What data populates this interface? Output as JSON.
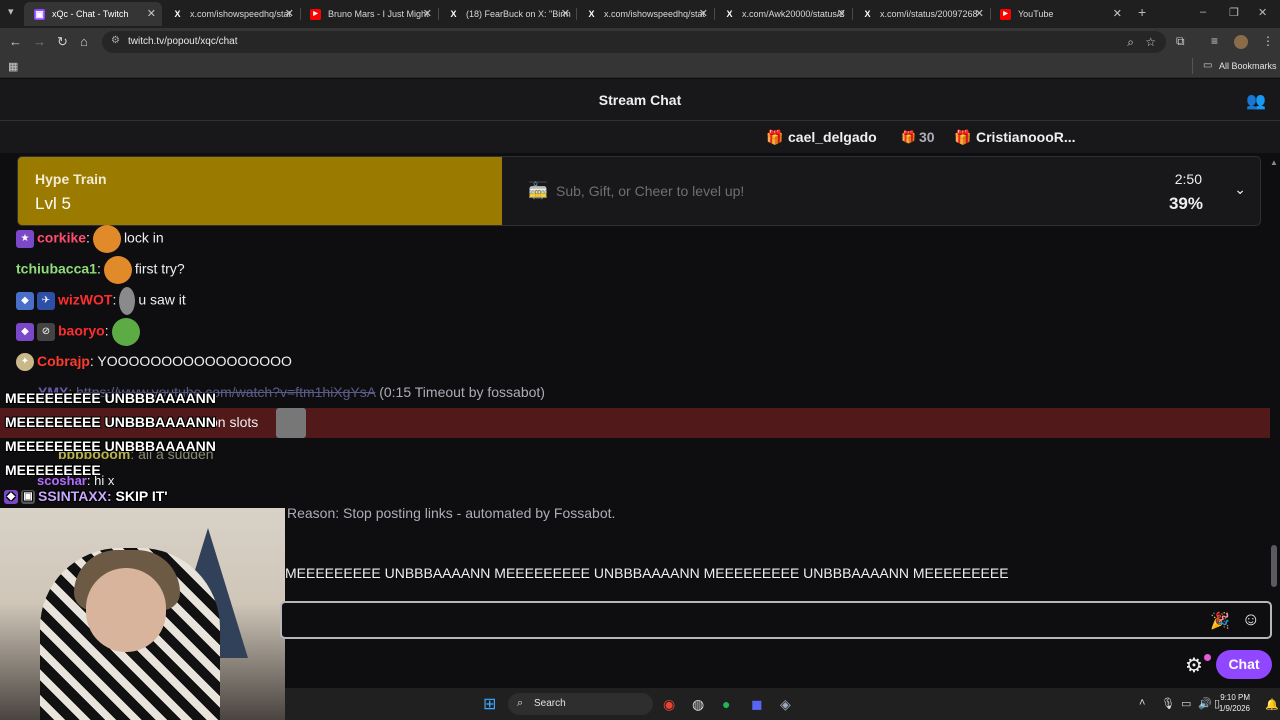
{
  "browser": {
    "tabs": [
      {
        "title": "xQc - Chat - Twitch",
        "active": true,
        "icon": "twitch-icon",
        "color": "#9147ff",
        "glyph": "▣"
      },
      {
        "title": "x.com/ishowspeedhq/stat",
        "icon": "x-icon",
        "color": "#ffffff",
        "glyph": "X"
      },
      {
        "title": "Bruno Mars - I Just Might",
        "icon": "youtube-icon",
        "color": "#ff0000",
        "glyph": "▶"
      },
      {
        "title": "(18) FearBuck on X: \"Birm",
        "icon": "x-icon",
        "color": "#ffffff",
        "glyph": "X"
      },
      {
        "title": "x.com/ishowspeedhq/stat",
        "icon": "x-icon",
        "color": "#ffffff",
        "glyph": "X"
      },
      {
        "title": "x.com/Awk20000/status/2",
        "icon": "x-icon",
        "color": "#ffffff",
        "glyph": "X"
      },
      {
        "title": "x.com/i/status/20097268",
        "icon": "x-icon",
        "color": "#ffffff",
        "glyph": "X"
      },
      {
        "title": "YouTube",
        "icon": "youtube-icon",
        "color": "#ff0000",
        "glyph": "▶"
      }
    ],
    "url": "twitch.tv/popout/xqc/chat",
    "all_bookmarks": "All Bookmarks"
  },
  "chat": {
    "title": "Stream Chat",
    "leaderboard": [
      {
        "name": "cael_delgado",
        "icon": "gift-icon",
        "glyph": "🎁"
      },
      {
        "count": "30",
        "icon": "bits-gift-icon",
        "glyph": "🎁"
      },
      {
        "name": "CristianoooR...",
        "icon": "gift-icon-2",
        "glyph": "🎁"
      }
    ],
    "hype_train": {
      "title": "Hype Train",
      "level": "Lvl 5",
      "cta": "Sub, Gift, or Cheer to level up!",
      "time": "2:50",
      "percent_label": "39%",
      "progress": 0.39,
      "color": "#9a7b00"
    },
    "messages": [
      {
        "user": "corkike",
        "color": "#ff4c6e",
        "text": "lock in"
      },
      {
        "user": "tchiubacca1",
        "color": "#8fdc7a",
        "text": "first try?"
      },
      {
        "user": "wizWOT",
        "color": "#ff2d2d",
        "text": "u saw it"
      },
      {
        "user": "baoryo",
        "color": "#ff2d2d",
        "text": ""
      },
      {
        "user": "Cobrajp",
        "color": "#ff3b2e",
        "text": "YOOOOOOOOOOOOOOOOO"
      }
    ],
    "timeout_link": "https://www.youtube.com/watch?v=ftm1hiXgYsA",
    "timeout_user": "YMX",
    "timeout_note": "(0:15 Timeout by fossabot)",
    "timeout_row_text": "on slots",
    "partial_msg_user": "bbbbooom",
    "partial_msg_text": "all a sudden",
    "sco_user": "scoshar",
    "sco_text": "hi x",
    "overlay_lines": [
      "MEEEEEEEEE UNBBBAAAANN",
      "MEEEEEEEEE UNBBBAAAANN",
      "MEEEEEEEEE UNBBBAAAANN",
      "MEEEEEEEEE"
    ],
    "overlay_user": "SSINTAXX:",
    "overlay_msg": "SKIP IT'",
    "reason": "Reason: Stop posting links - automated by Fossabot.",
    "meee_line": "MEEEEEEEEE UNBBBAAAANN MEEEEEEEEE UNBBBAAAANN MEEEEEEEEE UNBBBAAAANN MEEEEEEEEE",
    "chat_button": "Chat"
  },
  "taskbar": {
    "search": "Search",
    "time": "9:10 PM",
    "date": "1/9/2026"
  }
}
